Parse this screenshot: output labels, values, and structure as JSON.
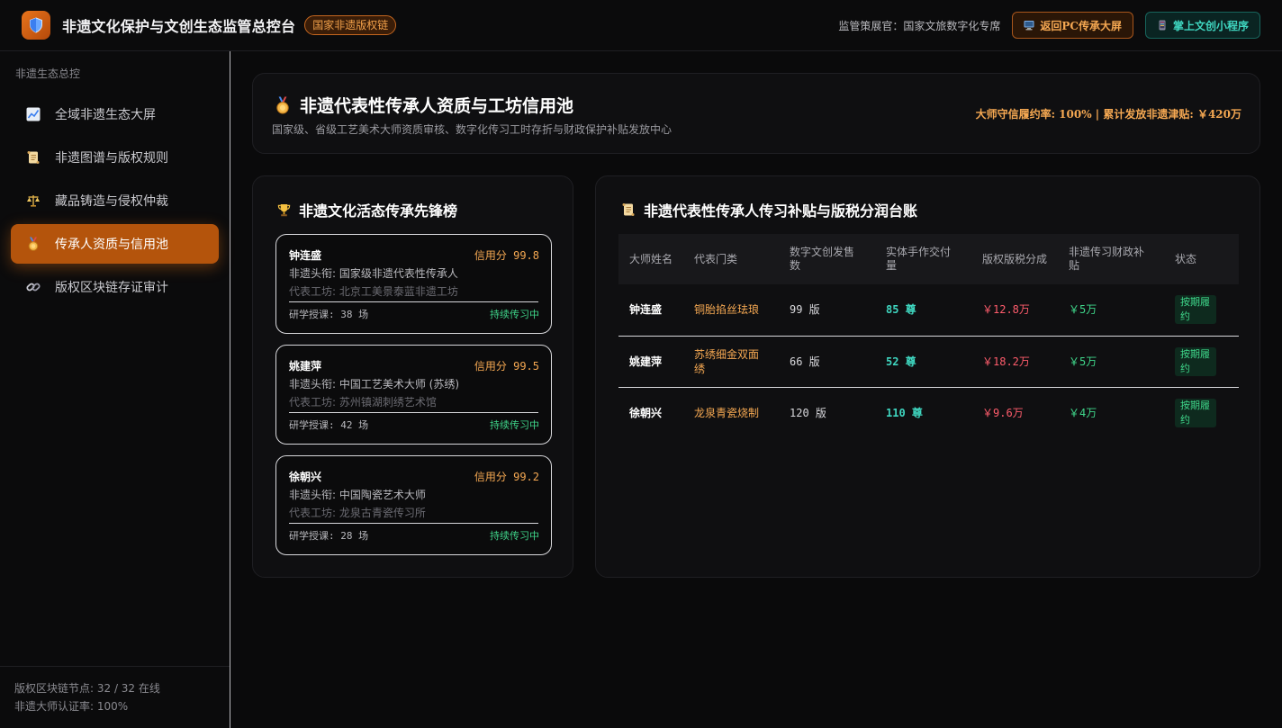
{
  "header": {
    "app_title": "非遗文化保护与文创生态监管总控台",
    "badge": "国家非遗版权链",
    "curator": "监管策展官：国家文旅数字化专席",
    "btn_pc": "返回PC传承大屏",
    "btn_mini": "掌上文创小程序",
    "icons": [
      "shield-icon",
      "monitor-icon",
      "phone-icon"
    ]
  },
  "sidebar": {
    "section": "非遗生态总控",
    "items": [
      {
        "label": "全域非遗生态大屏",
        "icon": "chart-line-icon",
        "active": false
      },
      {
        "label": "非遗图谱与版权规则",
        "icon": "scroll-icon",
        "active": false
      },
      {
        "label": "藏品铸造与侵权仲裁",
        "icon": "scales-icon",
        "active": false
      },
      {
        "label": "传承人资质与信用池",
        "icon": "medal-icon",
        "active": true
      },
      {
        "label": "版权区块链存证审计",
        "icon": "link-icon",
        "active": false
      }
    ],
    "footer": {
      "nodes": "版权区块链节点: 32 / 32 在线",
      "cert": "非遗大师认证率: 100%"
    }
  },
  "hero": {
    "title": "非遗代表性传承人资质与工坊信用池",
    "subtitle": "国家级、省级工艺美术大师资质审核、数字化传习工时存折与财政保护补贴发放中心",
    "stat": "大师守信履约率: 100% | 累计发放非遗津贴: ￥420万"
  },
  "leaderboard": {
    "title": "非遗文化活态传承先锋榜",
    "cards": [
      {
        "name": "钟连盛",
        "score": "信用分 99.8",
        "title": "非遗头衔: 国家级非遗代表性传承人",
        "shop": "代表工坊: 北京工美景泰蓝非遗工坊",
        "lessons": "研学授课: 38 场",
        "status": "持续传习中"
      },
      {
        "name": "姚建萍",
        "score": "信用分 99.5",
        "title": "非遗头衔: 中国工艺美术大师 (苏绣)",
        "shop": "代表工坊: 苏州镇湖刺绣艺术馆",
        "lessons": "研学授课: 42 场",
        "status": "持续传习中"
      },
      {
        "name": "徐朝兴",
        "score": "信用分 99.2",
        "title": "非遗头衔: 中国陶瓷艺术大师",
        "shop": "代表工坊: 龙泉古青瓷传习所",
        "lessons": "研学授课: 28 场",
        "status": "持续传习中"
      }
    ]
  },
  "ledger": {
    "title": "非遗代表性传承人传习补贴与版税分润台账",
    "columns": [
      "大师姓名",
      "代表门类",
      "数字文创发售数",
      "实体手作交付量",
      "版权版税分成",
      "非遗传习财政补贴",
      "状态"
    ],
    "rows": [
      {
        "name": "钟连盛",
        "category": "铜胎掐丝珐琅",
        "sales": "99 版",
        "delivery": "85 尊",
        "royalty": "￥12.8万",
        "subsidy": "￥5万",
        "status": "按期履约"
      },
      {
        "name": "姚建萍",
        "category": "苏绣细金双面绣",
        "sales": "66 版",
        "delivery": "52 尊",
        "royalty": "￥18.2万",
        "subsidy": "￥5万",
        "status": "按期履约"
      },
      {
        "name": "徐朝兴",
        "category": "龙泉青瓷烧制",
        "sales": "120 版",
        "delivery": "110 尊",
        "royalty": "￥9.6万",
        "subsidy": "￥4万",
        "status": "按期履约"
      }
    ]
  }
}
